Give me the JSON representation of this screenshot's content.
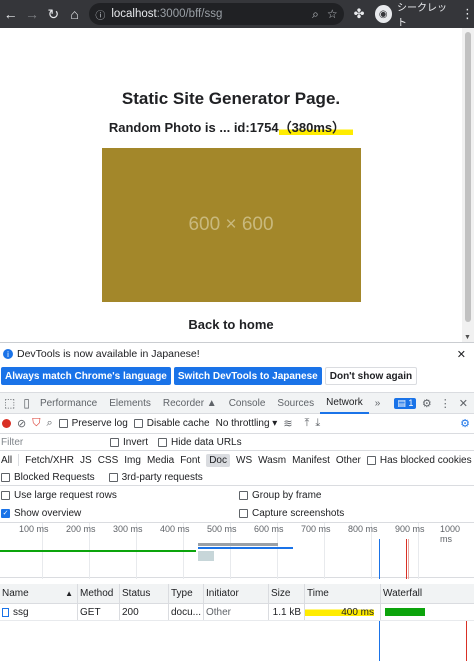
{
  "browser": {
    "url_host": "localhost",
    "url_path": ":3000/bff/ssg",
    "profile_label": "シークレット"
  },
  "page": {
    "heading": "Static Site Generator Page.",
    "subheading_prefix": "Random Photo is ... id:1754",
    "subheading_timing": "（380ms）",
    "photo_placeholder": "600 × 600",
    "back_link": "Back to home"
  },
  "devtools": {
    "info_message": "DevTools is now available in Japanese!",
    "btn_match_language": "Always match Chrome's language",
    "btn_switch_japanese": "Switch DevTools to Japanese",
    "btn_dont_show": "Don't show again",
    "tabs": [
      "Performance",
      "Elements",
      "Recorder ▲",
      "Console",
      "Sources",
      "Network"
    ],
    "active_tab": "Network",
    "more_tabs": "»",
    "issues_count": "1",
    "toolbar": {
      "preserve_log": "Preserve log",
      "disable_cache": "Disable cache",
      "throttling": "No throttling"
    },
    "filter": {
      "placeholder": "Filter",
      "invert": "Invert",
      "hide_data_urls": "Hide data URLs"
    },
    "types": [
      "All",
      "Fetch/XHR",
      "JS",
      "CSS",
      "Img",
      "Media",
      "Font",
      "Doc",
      "WS",
      "Wasm",
      "Manifest",
      "Other"
    ],
    "active_type": "Doc",
    "has_blocked_cookies": "Has blocked cookies",
    "blocked_requests": "Blocked Requests",
    "third_party": "3rd-party requests",
    "large_rows": "Use large request rows",
    "group_by_frame": "Group by frame",
    "show_overview": "Show overview",
    "capture_screenshots": "Capture screenshots",
    "timeline_ticks": [
      "100 ms",
      "200 ms",
      "300 ms",
      "400 ms",
      "500 ms",
      "600 ms",
      "700 ms",
      "800 ms",
      "900 ms",
      "1000 ms"
    ],
    "table": {
      "headers": [
        "Name",
        "Method",
        "Status",
        "Type",
        "Initiator",
        "Size",
        "Time",
        "Waterfall"
      ],
      "rows": [
        {
          "name": "ssg",
          "method": "GET",
          "status": "200",
          "type": "docu...",
          "initiator": "Other",
          "size": "1.1 kB",
          "time": "400 ms"
        }
      ]
    }
  }
}
